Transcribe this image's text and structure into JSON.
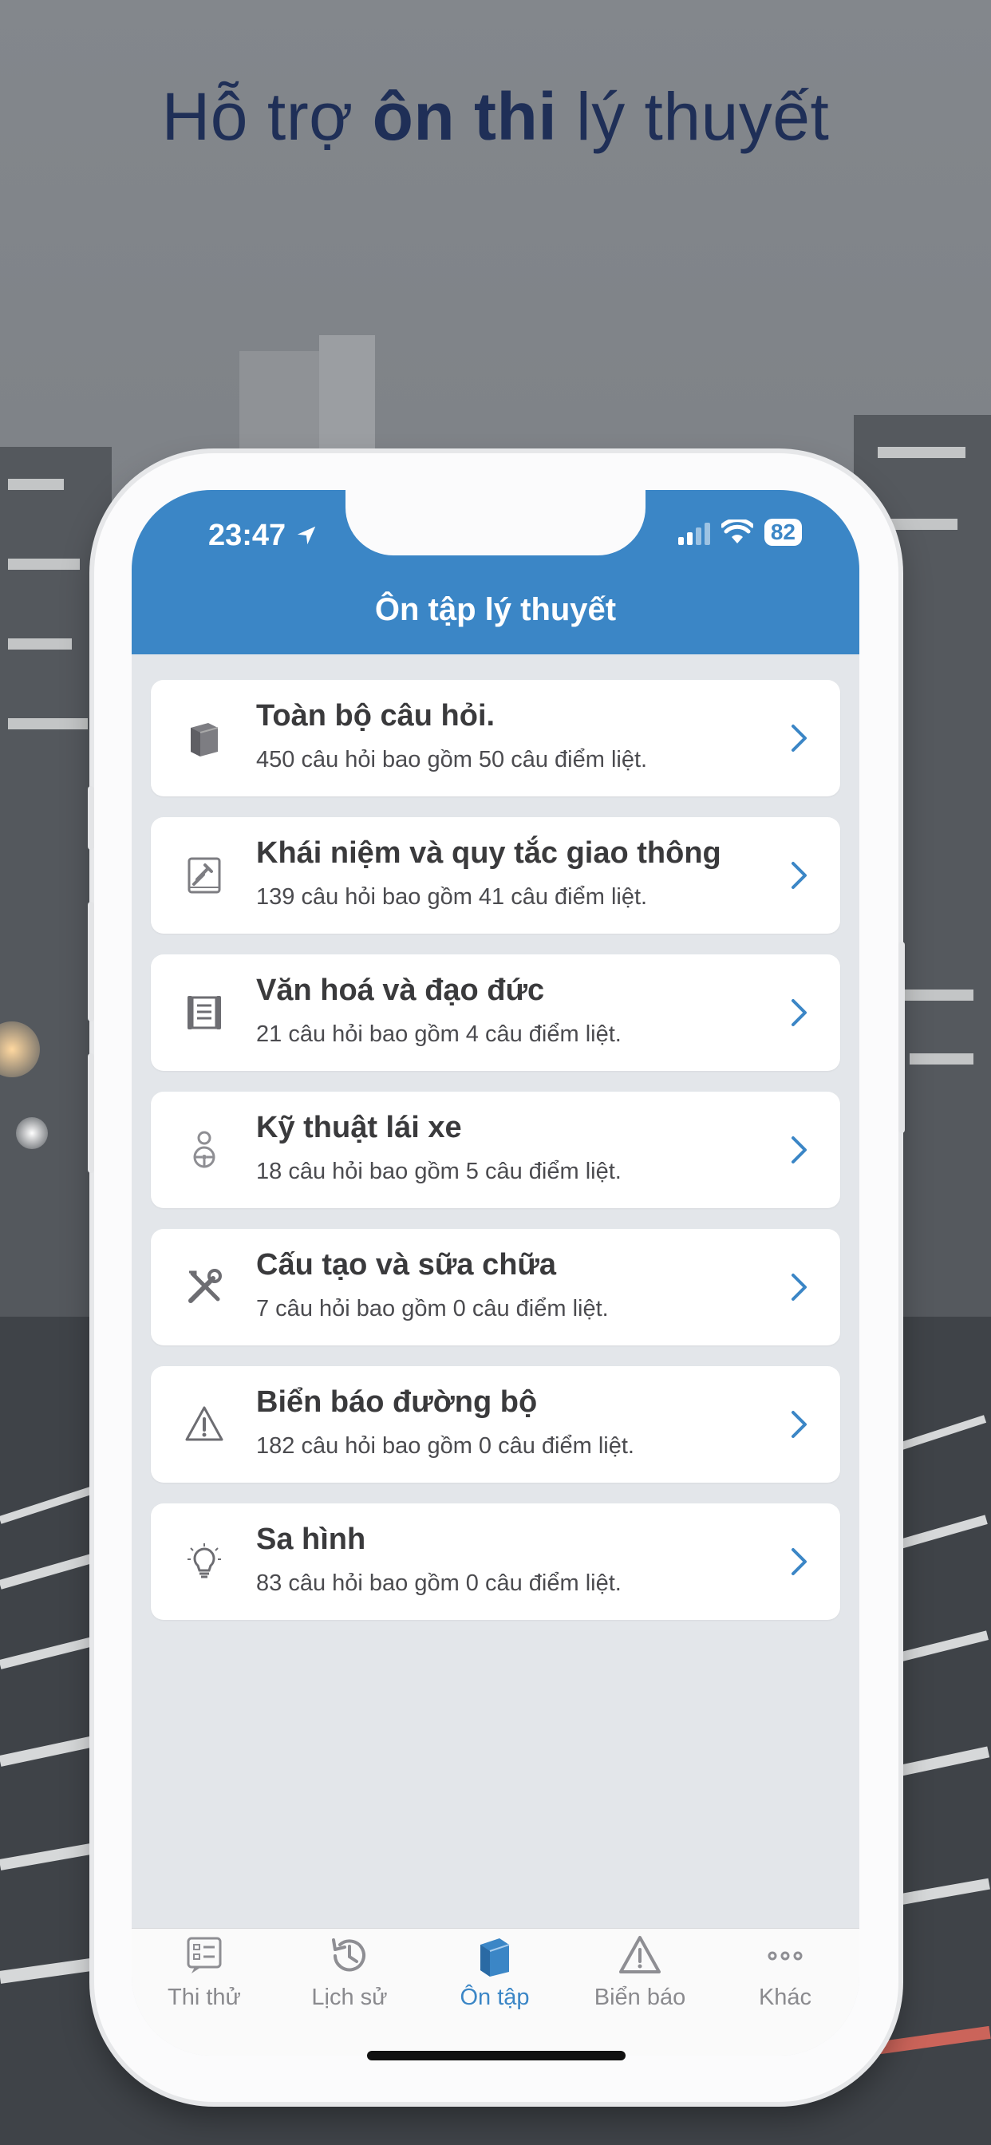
{
  "headline": {
    "part1": "Hỗ trợ ",
    "bold": "ôn thi",
    "part2": " lý thuyết"
  },
  "status_bar": {
    "time": "23:47",
    "battery": "82"
  },
  "header": {
    "title": "Ôn tập lý thuyết"
  },
  "categories": [
    {
      "title": "Toàn bộ câu hỏi.",
      "subtitle": "450 câu hỏi bao gồm 50 câu điểm liệt.",
      "icon": "book-icon"
    },
    {
      "title": "Khái niệm và quy tắc giao thông",
      "subtitle": "139 câu hỏi bao gồm 41 câu điểm liệt.",
      "icon": "law-book-icon"
    },
    {
      "title": "Văn hoá và đạo đức",
      "subtitle": "21 câu hỏi bao gồm 4 câu điểm liệt.",
      "icon": "scroll-icon"
    },
    {
      "title": "Kỹ thuật lái xe",
      "subtitle": "18 câu hỏi bao gồm 5 câu điểm liệt.",
      "icon": "driver-icon"
    },
    {
      "title": "Cấu tạo và sữa chữa",
      "subtitle": "7 câu hỏi bao gồm 0 câu điểm liệt.",
      "icon": "tools-icon"
    },
    {
      "title": "Biển báo đường bộ",
      "subtitle": "182 câu hỏi bao gồm 0 câu điểm liệt.",
      "icon": "warning-icon"
    },
    {
      "title": "Sa hình",
      "subtitle": "83 câu hỏi bao gồm 0 câu điểm liệt.",
      "icon": "lightbulb-icon"
    }
  ],
  "tabs": [
    {
      "label": "Thi thử",
      "icon": "exam-icon",
      "active": false
    },
    {
      "label": "Lịch sử",
      "icon": "history-icon",
      "active": false
    },
    {
      "label": "Ôn tập",
      "icon": "book-icon",
      "active": true
    },
    {
      "label": "Biển báo",
      "icon": "warning-icon",
      "active": false
    },
    {
      "label": "Khác",
      "icon": "more-icon",
      "active": false
    }
  ],
  "colors": {
    "accent": "#3b86c6",
    "headline": "#1f2f57",
    "icon_gray": "#8e8e93"
  }
}
